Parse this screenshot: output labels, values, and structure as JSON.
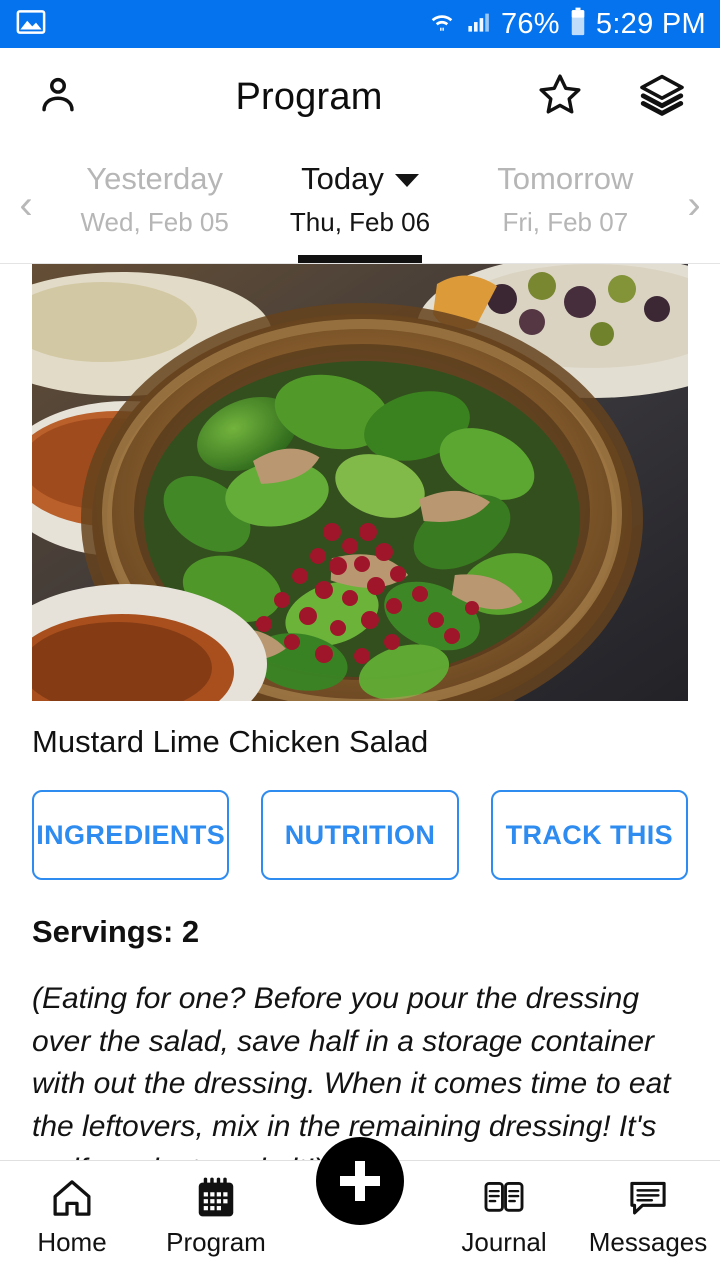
{
  "status_bar": {
    "background": "#0573ee",
    "left_icon": "image-icon",
    "icons": [
      "wifi-icon",
      "cellular-signal-icon",
      "battery-icon"
    ],
    "battery_percent": "76%",
    "time": "5:29 PM"
  },
  "app_bar": {
    "profile_icon": "person-icon",
    "title": "Program",
    "star_icon": "star-outline-icon",
    "layers_icon": "layers-icon"
  },
  "day_selector": {
    "prev_arrow": "‹",
    "next_arrow": "›",
    "days": [
      {
        "label": "Yesterday",
        "sub": "Wed, Feb 05",
        "active": false
      },
      {
        "label": "Today",
        "sub": "Thu, Feb 06",
        "active": true
      },
      {
        "label": "Tomorrow",
        "sub": "Fri, Feb 07",
        "active": false
      }
    ]
  },
  "recipe": {
    "photo_alt": "mustard-lime-chicken-salad-photo",
    "title": "Mustard Lime Chicken Salad",
    "actions": [
      {
        "label": "INGREDIENTS"
      },
      {
        "label": "NUTRITION"
      },
      {
        "label": "TRACK THIS"
      }
    ],
    "servings": "Servings: 2",
    "note": "(Eating for one? Before you pour the dressing over the salad, save half in a storage container with out the dressing. When it comes time to eat the leftovers, mix in the remaining dressing! It's as if you just made it!)"
  },
  "bottom_nav": {
    "items": [
      {
        "label": "Home",
        "icon": "home-icon"
      },
      {
        "label": "Program",
        "icon": "calendar-icon"
      },
      {
        "label": "Journal",
        "icon": "book-icon"
      },
      {
        "label": "Messages",
        "icon": "message-bubble-icon"
      }
    ],
    "fab": {
      "icon": "plus-icon"
    }
  },
  "colors": {
    "status_bar_blue": "#0573ee",
    "accent_blue": "#2e8bef",
    "text_primary": "#111111",
    "text_muted": "#b6b6b6",
    "fab_black": "#000000"
  }
}
